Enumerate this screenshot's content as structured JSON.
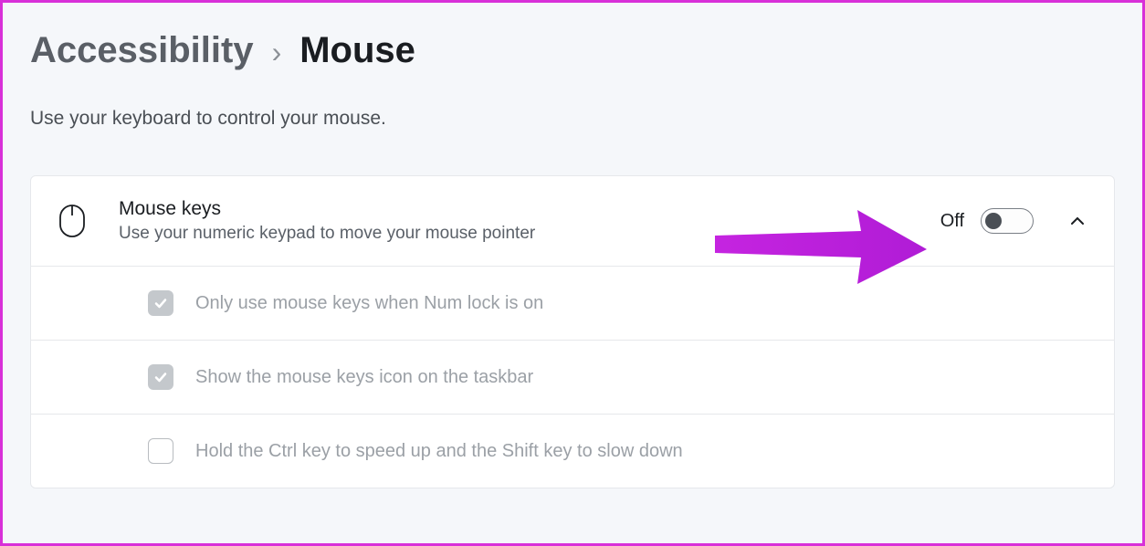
{
  "breadcrumb": {
    "parent": "Accessibility",
    "current": "Mouse"
  },
  "subtitle": "Use your keyboard to control your mouse.",
  "mouseKeys": {
    "title": "Mouse keys",
    "description": "Use your numeric keypad to move your mouse pointer",
    "toggleState": "Off"
  },
  "options": [
    {
      "label": "Only use mouse keys when Num lock is on",
      "checked": true
    },
    {
      "label": "Show the mouse keys icon on the taskbar",
      "checked": true
    },
    {
      "label": "Hold the Ctrl key to speed up and the Shift key to slow down",
      "checked": false
    }
  ]
}
